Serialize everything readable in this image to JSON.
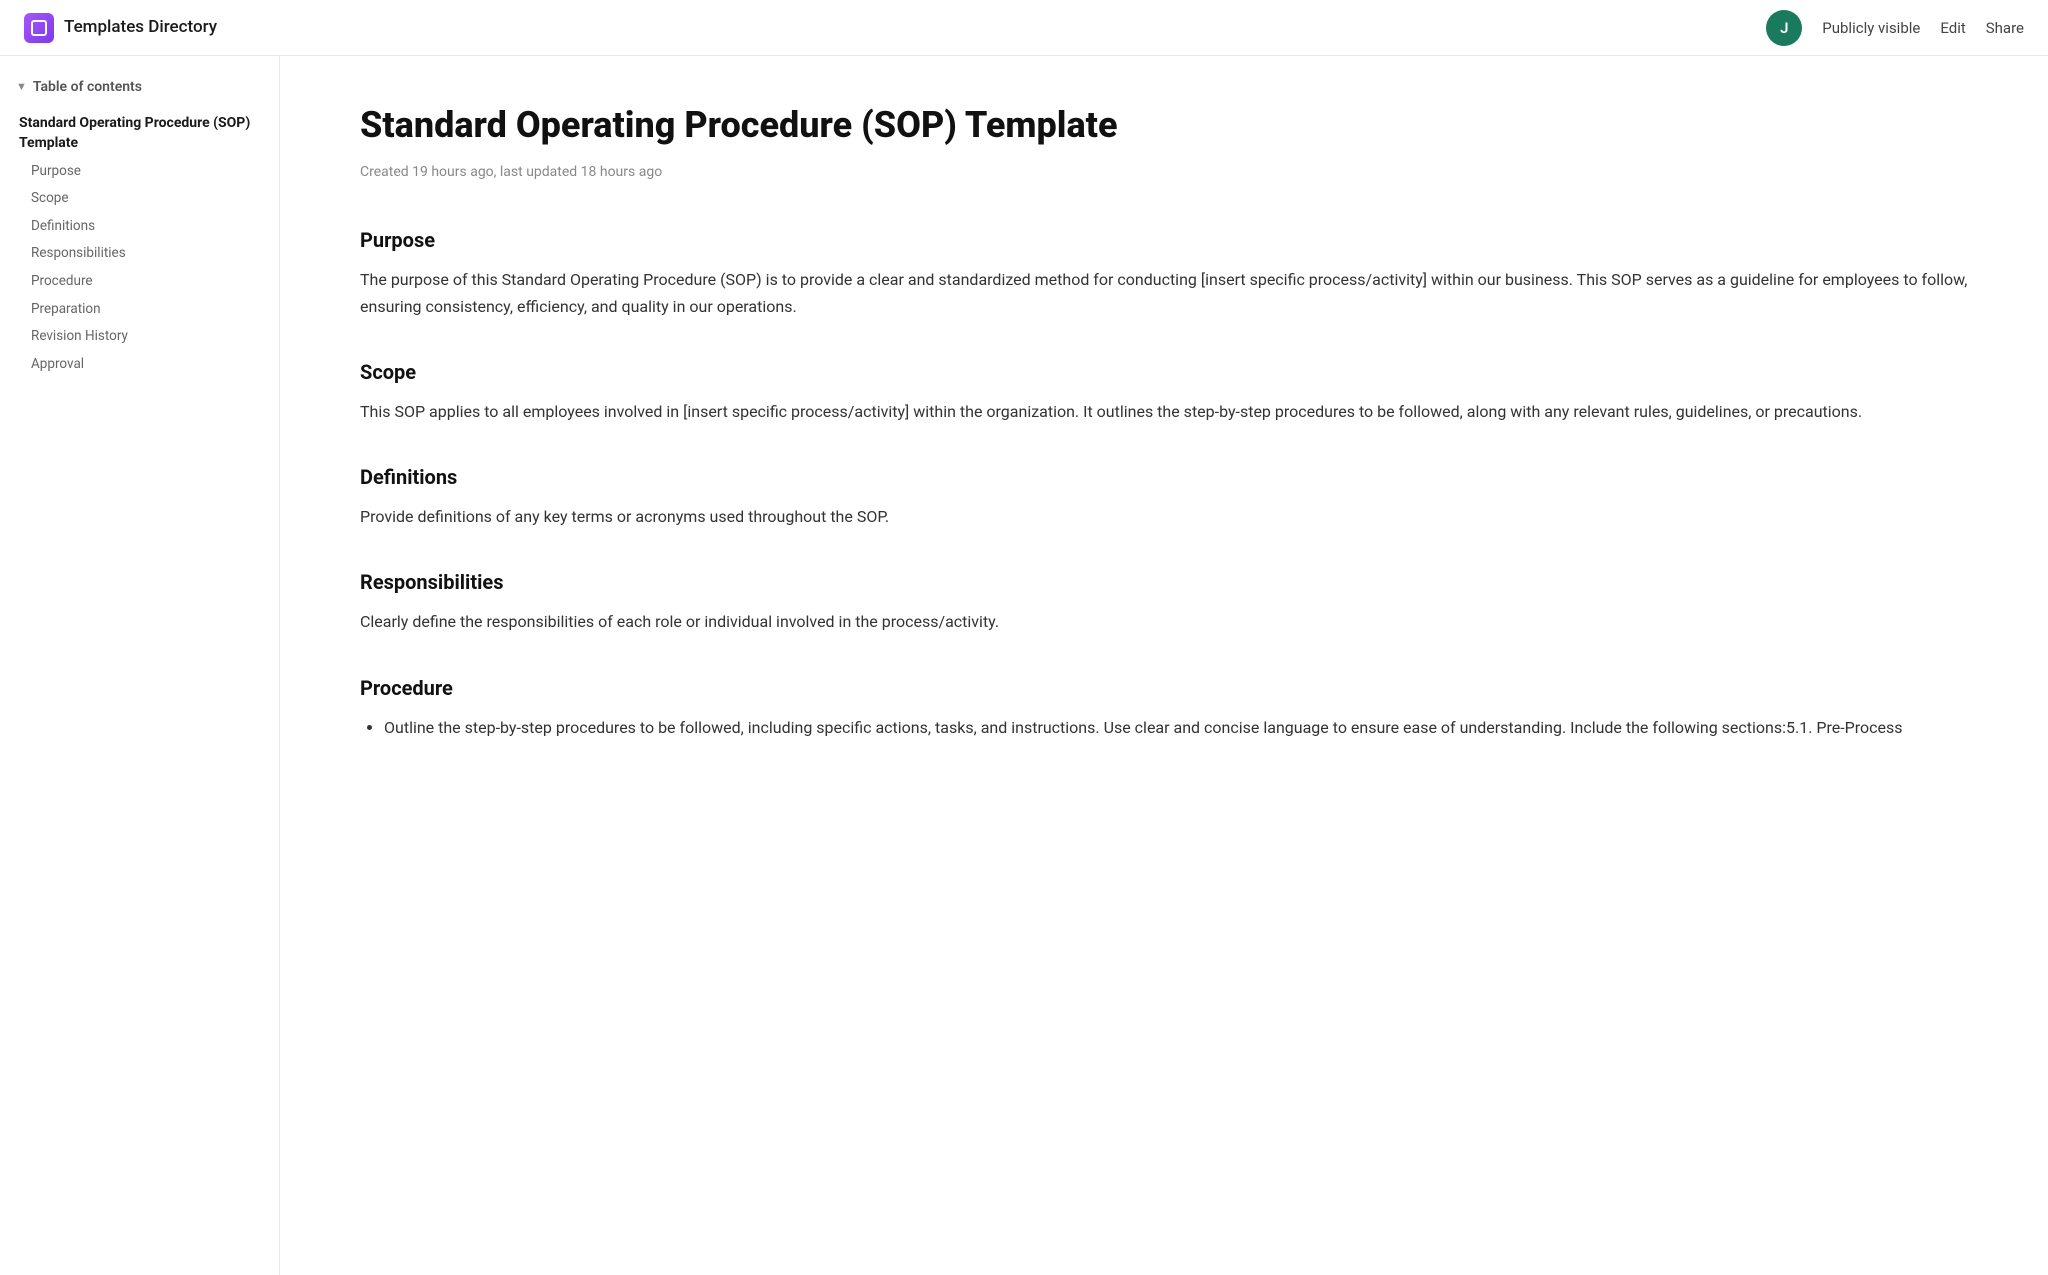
{
  "header": {
    "app_icon_label": "app-icon",
    "app_title": "Templates Directory",
    "avatar_letter": "J",
    "publicly_visible": "Publicly visible",
    "edit_label": "Edit",
    "share_label": "Share"
  },
  "sidebar": {
    "toc_label": "Table of contents",
    "main_item": "Standard Operating Procedure (SOP) Template",
    "sub_items": [
      "Purpose",
      "Scope",
      "Definitions",
      "Responsibilities",
      "Procedure",
      "Preparation",
      "Revision History",
      "Approval"
    ]
  },
  "document": {
    "title": "Standard Operating Procedure (SOP) Template",
    "meta": "Created 19 hours ago, last updated 18 hours ago",
    "sections": [
      {
        "id": "purpose",
        "heading": "Purpose",
        "body": "The purpose of this Standard Operating Procedure (SOP) is to provide a clear and standardized method for conducting [insert specific process/activity] within our business. This SOP serves as a guideline for employees to follow, ensuring consistency, efficiency, and quality in our operations.",
        "list": []
      },
      {
        "id": "scope",
        "heading": "Scope",
        "body": "This SOP applies to all employees involved in [insert specific process/activity] within the organization. It outlines the step-by-step procedures to be followed, along with any relevant rules, guidelines, or precautions.",
        "list": []
      },
      {
        "id": "definitions",
        "heading": "Definitions",
        "body": "Provide definitions of any key terms or acronyms used throughout the SOP.",
        "list": []
      },
      {
        "id": "responsibilities",
        "heading": "Responsibilities",
        "body": "Clearly define the responsibilities of each role or individual involved in the process/activity.",
        "list": []
      },
      {
        "id": "procedure",
        "heading": "Procedure",
        "body": "",
        "list": [
          "Outline the step-by-step procedures to be followed, including specific actions, tasks, and instructions. Use clear and concise language to ensure ease of understanding. Include the following sections:5.1. Pre-Process"
        ]
      }
    ]
  }
}
